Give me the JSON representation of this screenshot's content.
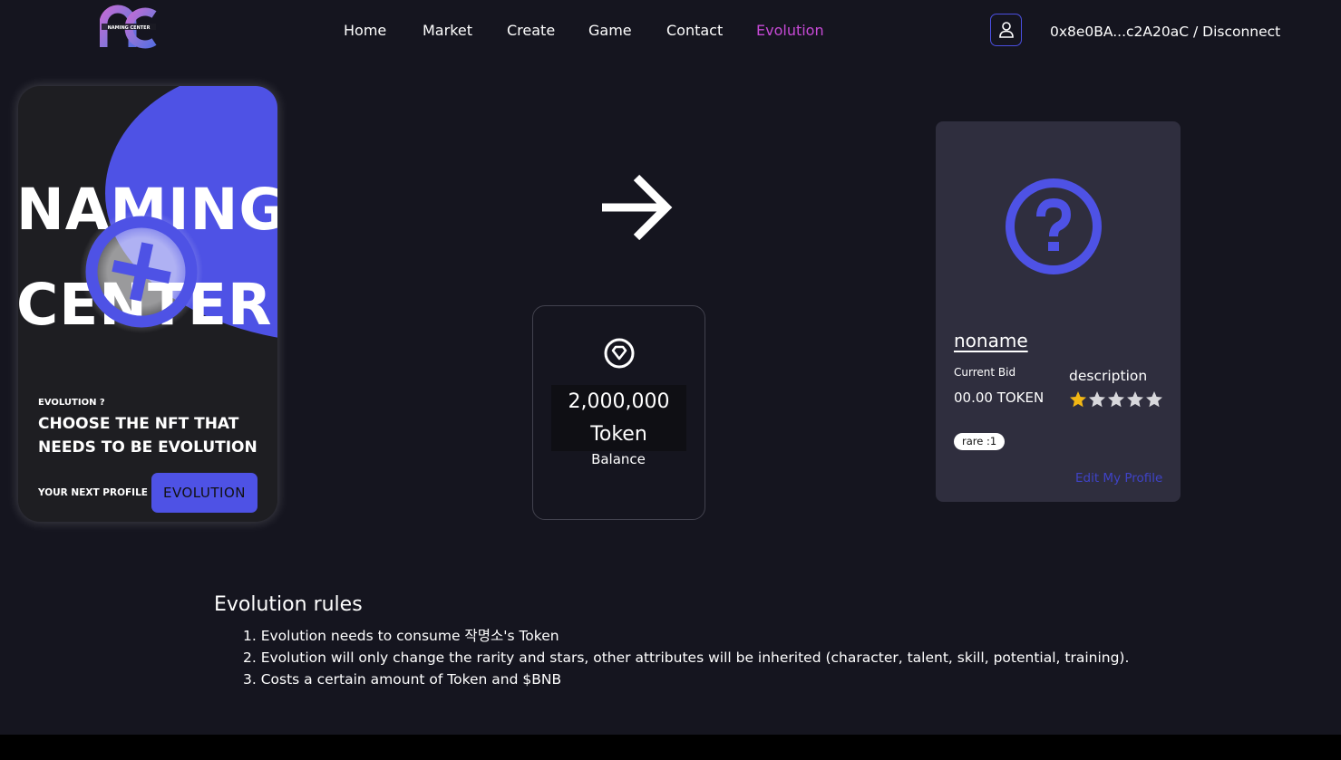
{
  "header": {
    "logo_text": "NAMING CENTER",
    "nav": [
      {
        "label": "Home"
      },
      {
        "label": "Market"
      },
      {
        "label": "Create"
      },
      {
        "label": "Game"
      },
      {
        "label": "Contact"
      },
      {
        "label": "Evolution",
        "active": true
      }
    ],
    "user_icon": "user-icon",
    "wallet": "0x8e0BA...c2A20aC / Disconnect"
  },
  "left_card": {
    "big_line1": "NAMING",
    "big_line2": "CENTER",
    "eyebrow": "EVOLUTION ?",
    "headline": "CHOOSE THE NFT THAT NEEDS TO BE EVOLUTION",
    "next_profile": "YOUR NEXT PROFILE",
    "button": "EVOLUTION"
  },
  "balance": {
    "icon": "diamond-icon",
    "amount": "2,000,000",
    "unit": "Token",
    "label": "Balance"
  },
  "right_card": {
    "icon": "question-icon",
    "name": "noname",
    "bid_label": "Current Bid",
    "bid_value": "00.00 TOKEN",
    "description": "description",
    "stars_filled": 1,
    "stars_total": 5,
    "rare": "rare :1",
    "edit": "Edit My Profile"
  },
  "rules": {
    "title": "Evolution rules",
    "items": [
      "1. Evolution needs to consume 작명소's Token",
      "2. Evolution will only change the rarity and stars, other attributes will be inherited (character, talent, skill, potential, training).",
      "3. Costs a certain amount of Token and $BNB"
    ]
  },
  "colors": {
    "background": "#15151f",
    "accent": "#4e52e5",
    "active_nav": "#c74ad6",
    "card": "#2f2e3e",
    "star_gold": "#f2b714",
    "star_grey": "#d8d8dc"
  }
}
